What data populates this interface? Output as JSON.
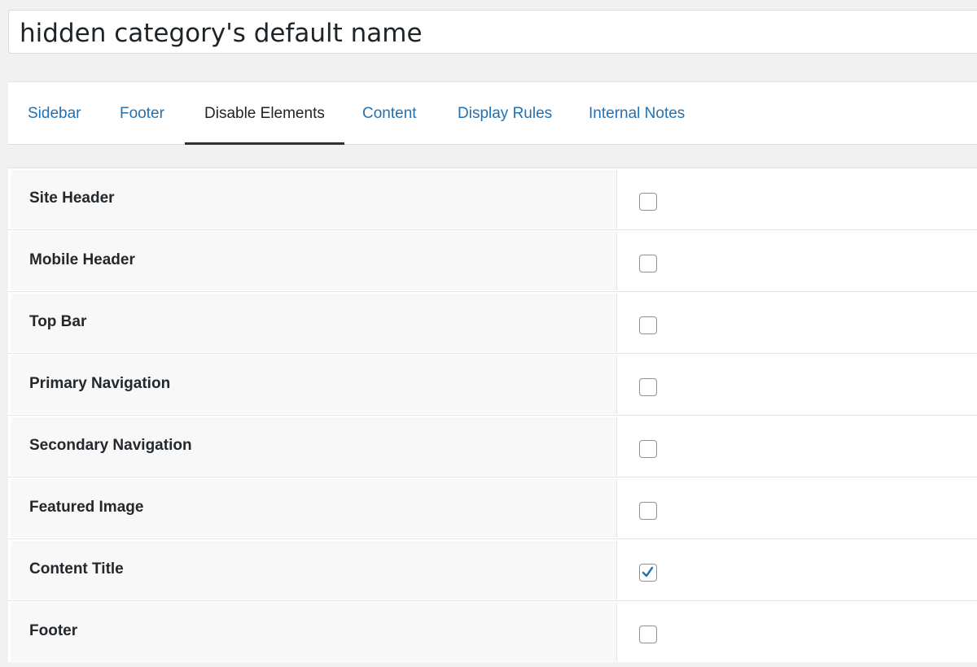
{
  "title": {
    "value": "hidden category's default name"
  },
  "tabs": [
    {
      "label": "Sidebar",
      "active": false
    },
    {
      "label": "Footer",
      "active": false
    },
    {
      "label": "Disable Elements",
      "active": true
    },
    {
      "label": "Content",
      "active": false
    },
    {
      "label": "Display Rules",
      "active": false
    },
    {
      "label": "Internal Notes",
      "active": false
    }
  ],
  "options": [
    {
      "label": "Site Header",
      "checked": false
    },
    {
      "label": "Mobile Header",
      "checked": false
    },
    {
      "label": "Top Bar",
      "checked": false
    },
    {
      "label": "Primary Navigation",
      "checked": false
    },
    {
      "label": "Secondary Navigation",
      "checked": false
    },
    {
      "label": "Featured Image",
      "checked": false
    },
    {
      "label": "Content Title",
      "checked": true
    },
    {
      "label": "Footer",
      "checked": false
    }
  ],
  "colors": {
    "link": "#2271b1",
    "active_tab_underline": "#2c3338",
    "check_mark": "#2271b1"
  }
}
